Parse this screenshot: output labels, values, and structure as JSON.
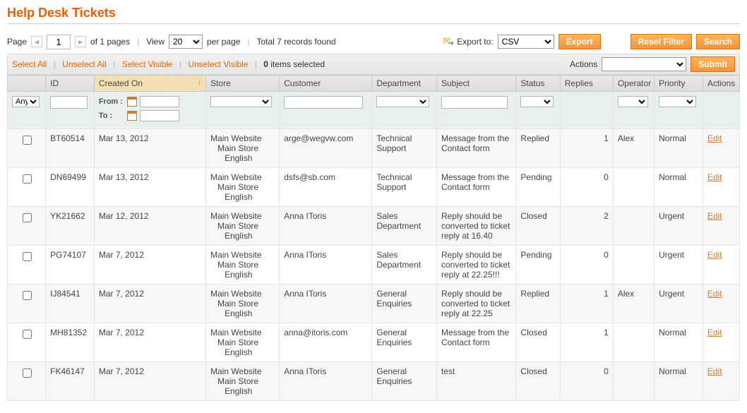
{
  "page_title": "Help Desk Tickets",
  "toolbar": {
    "page_label": "Page",
    "page_value": "1",
    "of_pages": "of 1 pages",
    "view_label": "View",
    "per_page_value": "20",
    "per_page_label": "per page",
    "total_records": "Total 7 records found",
    "export_to_label": "Export to:",
    "export_format": "CSV",
    "export_button": "Export",
    "reset_filter": "Reset Filter",
    "search": "Search"
  },
  "massbar": {
    "select_all": "Select All",
    "unselect_all": "Unselect All",
    "select_visible": "Select Visible",
    "unselect_visible": "Unselect Visible",
    "items_selected": "0 items selected",
    "actions_label": "Actions",
    "submit": "Submit"
  },
  "headers": {
    "id": "ID",
    "created_on": "Created On",
    "store": "Store",
    "customer": "Customer",
    "department": "Department",
    "subject": "Subject",
    "status": "Status",
    "replies": "Replies",
    "operator": "Operator",
    "priority": "Priority",
    "actions": "Actions"
  },
  "filters": {
    "any": "Any",
    "from": "From :",
    "to": "To :"
  },
  "store_lines": {
    "l1": "Main Website",
    "l2": "Main Store",
    "l3": "English"
  },
  "edit_label": "Edit",
  "rows": [
    {
      "id": "BT60514",
      "created": "Mar 13, 2012",
      "customer": "arge@wegvw.com",
      "department": "Technical Support",
      "subject": "Message from the Contact form",
      "status": "Replied",
      "replies": "1",
      "operator": "Alex",
      "priority": "Normal"
    },
    {
      "id": "DN69499",
      "created": "Mar 13, 2012",
      "customer": "dsfs@sb.com",
      "department": "Technical Support",
      "subject": "Message from the Contact form",
      "status": "Pending",
      "replies": "0",
      "operator": "",
      "priority": "Normal"
    },
    {
      "id": "YK21662",
      "created": "Mar 12, 2012",
      "customer": "Anna IToris",
      "department": "Sales Department",
      "subject": "Reply should be converted to ticket reply at 16.40",
      "status": "Closed",
      "replies": "2",
      "operator": "",
      "priority": "Urgent"
    },
    {
      "id": "PG74107",
      "created": "Mar 7, 2012",
      "customer": "Anna IToris",
      "department": "Sales Department",
      "subject": "Reply should be converted to ticket reply at 22.25!!!",
      "status": "Pending",
      "replies": "0",
      "operator": "",
      "priority": "Urgent"
    },
    {
      "id": "IJ84541",
      "created": "Mar 7, 2012",
      "customer": "Anna IToris",
      "department": "General Enquiries",
      "subject": "Reply should be converted to ticket reply at 22.25",
      "status": "Replied",
      "replies": "1",
      "operator": "Alex",
      "priority": "Urgent"
    },
    {
      "id": "MH81352",
      "created": "Mar 7, 2012",
      "customer": "anna@itoris.com",
      "department": "General Enquiries",
      "subject": "Message from the Contact form",
      "status": "Closed",
      "replies": "1",
      "operator": "",
      "priority": "Normal"
    },
    {
      "id": "FK46147",
      "created": "Mar 7, 2012",
      "customer": "Anna IToris",
      "department": "General Enquiries",
      "subject": "test",
      "status": "Closed",
      "replies": "0",
      "operator": "",
      "priority": "Normal"
    }
  ]
}
